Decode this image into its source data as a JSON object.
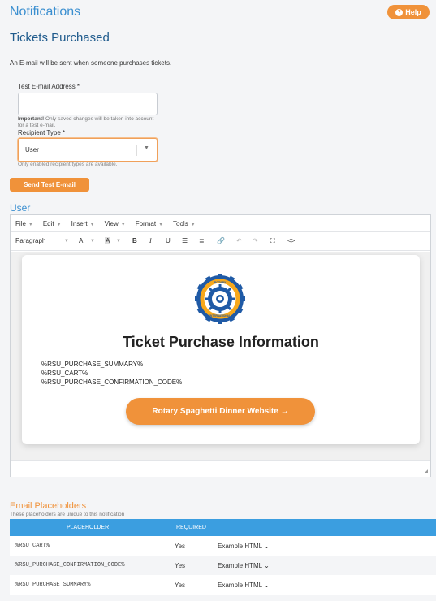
{
  "header": {
    "title": "Notifications",
    "help_label": "Help"
  },
  "section": {
    "title": "Tickets Purchased",
    "intro": "An E-mail will be sent when someone purchases tickets."
  },
  "form": {
    "email_label": "Test E-mail Address *",
    "email_value": "",
    "important_bold": "Important!",
    "important_text": " Only saved changes will be taken into account for a test e-mail.",
    "recipient_label": "Recipient Type *",
    "recipient_value": "User",
    "recipient_hint": "Only enabled recipient types are available.",
    "send_button": "Send Test E-mail"
  },
  "editor": {
    "section_title": "User",
    "menu": [
      "File",
      "Edit",
      "Insert",
      "View",
      "Format",
      "Tools"
    ],
    "toolbar": {
      "block_format": "Paragraph"
    },
    "card_title": "Ticket Purchase Information",
    "placeholders": [
      "%RSU_PURCHASE_SUMMARY%",
      "%RSU_CART%",
      "%RSU_PURCHASE_CONFIRMATION_CODE%"
    ],
    "cta_label": "Rotary Spaghetti Dinner Website →",
    "logo_text": {
      "top": "ROTARY",
      "bottom": "INTERNATIONAL"
    }
  },
  "placeholders_table": {
    "title": "Email Placeholders",
    "description": "These placeholders are unique to this notification",
    "headers": [
      "PLACEHOLDER",
      "REQUIRED"
    ],
    "rows": [
      {
        "code": "%RSU_CART%",
        "required": "Yes",
        "example": "Example HTML"
      },
      {
        "code": "%RSU_PURCHASE_CONFIRMATION_CODE%",
        "required": "Yes",
        "example": "Example HTML"
      },
      {
        "code": "%RSU_PURCHASE_SUMMARY%",
        "required": "Yes",
        "example": "Example HTML"
      }
    ]
  },
  "colors": {
    "accent": "#f0923a",
    "primary": "#3b8fd0",
    "rotary_blue": "#1f5aa6",
    "rotary_gold": "#f7a81b"
  }
}
